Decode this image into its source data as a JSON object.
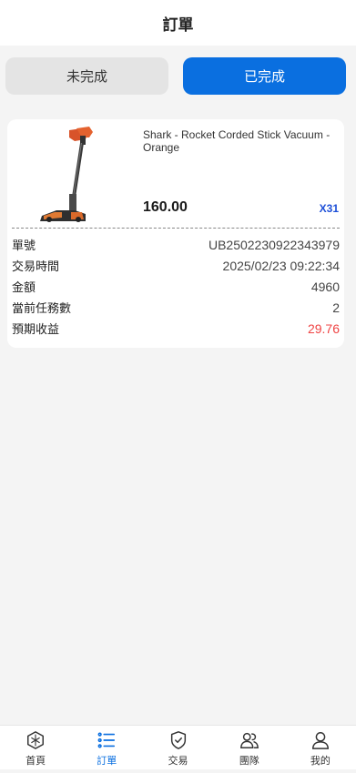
{
  "header": {
    "title": "訂單"
  },
  "tabs": {
    "pending": "未完成",
    "completed": "已完成"
  },
  "order": {
    "product_name": "Shark - Rocket Corded Stick Vacuum - Orange",
    "price": "160.00",
    "quantity": "X31",
    "details": [
      {
        "label": "單號",
        "value": "UB2502230922343979"
      },
      {
        "label": "交易時間",
        "value": "2025/02/23 09:22:34"
      },
      {
        "label": "金額",
        "value": "4960"
      },
      {
        "label": "當前任務數",
        "value": "2"
      },
      {
        "label": "預期收益",
        "value": "29.76"
      }
    ]
  },
  "tabbar": {
    "items": [
      {
        "label": "首頁",
        "icon": "home-icon"
      },
      {
        "label": "訂單",
        "icon": "list-icon"
      },
      {
        "label": "交易",
        "icon": "shield-check-icon"
      },
      {
        "label": "團隊",
        "icon": "team-icon"
      },
      {
        "label": "我的",
        "icon": "user-icon"
      }
    ]
  },
  "colors": {
    "accent": "#0a6fe0",
    "profit": "#ef4444",
    "quantity": "#1e50d8"
  }
}
